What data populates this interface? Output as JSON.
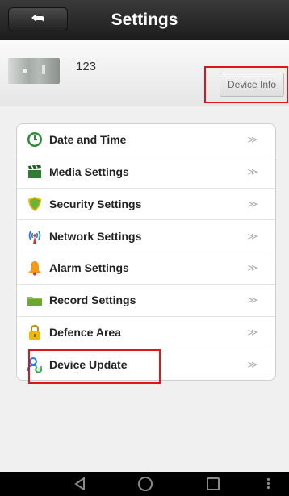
{
  "header": {
    "title": "Settings",
    "back_icon": "back-arrow-icon"
  },
  "device": {
    "name": "123",
    "info_button": "Device Info"
  },
  "menu": {
    "items": [
      {
        "label": "Date and Time",
        "icon": "clock-icon",
        "chevron": "≫"
      },
      {
        "label": "Media Settings",
        "icon": "clapperboard-icon",
        "chevron": "≫"
      },
      {
        "label": "Security Settings",
        "icon": "shield-icon",
        "chevron": "≫"
      },
      {
        "label": "Network Settings",
        "icon": "antenna-icon",
        "chevron": "≫"
      },
      {
        "label": "Alarm Settings",
        "icon": "bell-icon",
        "chevron": "≫"
      },
      {
        "label": "Record Settings",
        "icon": "folder-icon",
        "chevron": "≫"
      },
      {
        "label": "Defence Area",
        "icon": "lock-icon",
        "chevron": "≫"
      },
      {
        "label": "Device Update",
        "icon": "user-update-icon",
        "chevron": "≫"
      }
    ]
  },
  "navbar": {
    "icons": [
      "nav-back-icon",
      "nav-home-icon",
      "nav-recent-icon",
      "nav-menu-icon"
    ]
  },
  "colors": {
    "highlight": "#e0151b",
    "topbar": "#2a2a2a"
  }
}
